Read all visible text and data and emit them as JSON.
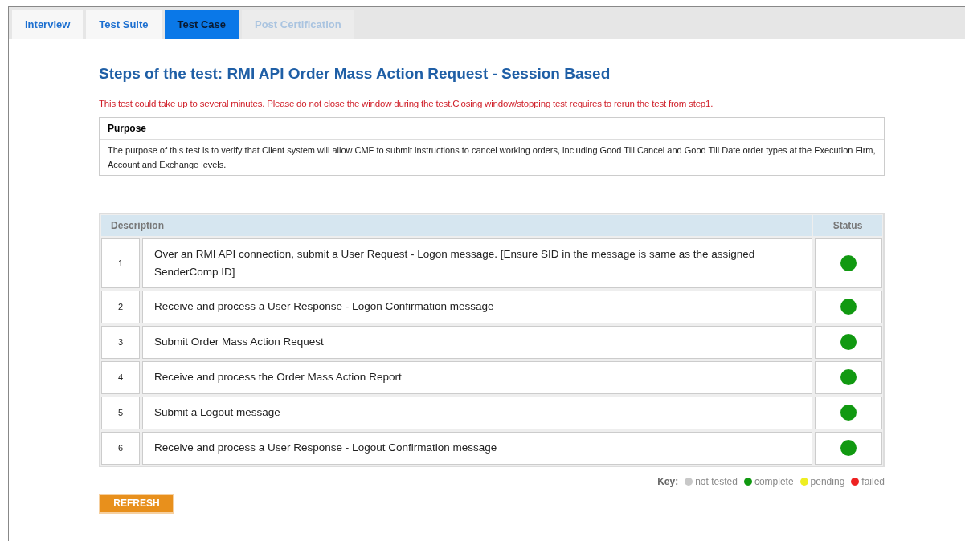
{
  "tabs": [
    {
      "label": "Interview",
      "selected": false,
      "disabled": false
    },
    {
      "label": "Test Suite",
      "selected": false,
      "disabled": false
    },
    {
      "label": "Test Case",
      "selected": true,
      "disabled": false
    },
    {
      "label": "Post Certification",
      "selected": false,
      "disabled": true
    }
  ],
  "title": "Steps of the test: RMI API Order Mass Action Request - Session Based",
  "warning": "This test could take up to several minutes. Please do not close the window during the test.Closing window/stopping test requires to rerun the test from step1.",
  "purpose": {
    "heading": "Purpose",
    "text": "The purpose of this test is to verify that Client system will allow CMF to submit instructions to cancel working orders, including Good Till Cancel and Good Till Date order types at the Execution Firm, Account and Exchange levels."
  },
  "table": {
    "columns": [
      "Description",
      "Status"
    ],
    "rows": [
      {
        "number": "1",
        "description": "Over an RMI API connection, submit a User Request - Logon message. [Ensure SID in the message is same as the assigned SenderComp ID]",
        "color": "#119911"
      },
      {
        "number": "2",
        "description": "Receive and process a User Response - Logon Confirmation message",
        "color": "#119911"
      },
      {
        "number": "3",
        "description": "Submit Order Mass Action Request",
        "color": "#119911"
      },
      {
        "number": "4",
        "description": "Receive and process the Order Mass Action Report",
        "color": "#119911"
      },
      {
        "number": "5",
        "description": "Submit a Logout message",
        "color": "#119911"
      },
      {
        "number": "6",
        "description": "Receive and process a User Response - Logout Confirmation message",
        "color": "#119911"
      }
    ]
  },
  "key": {
    "label": "Key:",
    "items": [
      {
        "label": "not tested",
        "color": "#c8c8c8"
      },
      {
        "label": "complete",
        "color": "#119911"
      },
      {
        "label": "pending",
        "color": "#eeee22"
      },
      {
        "label": "failed",
        "color": "#ee2222"
      }
    ]
  },
  "refresh_button": "REFRESH"
}
